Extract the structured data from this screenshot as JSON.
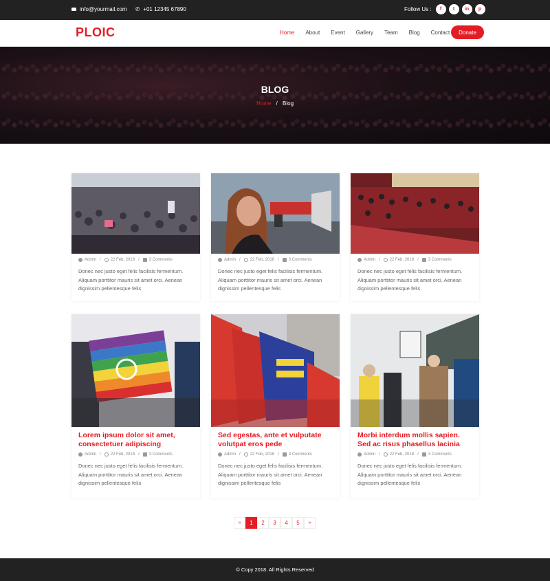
{
  "topbar": {
    "email": "info@yourmail.com",
    "phone": "+01 12345 67890",
    "follow_label": "Follow Us :",
    "social": [
      {
        "icon": "facebook-icon",
        "glyph": "f"
      },
      {
        "icon": "twitter-icon",
        "glyph": "t"
      },
      {
        "icon": "linkedin-icon",
        "glyph": "in"
      },
      {
        "icon": "pinterest-icon",
        "glyph": "p"
      }
    ]
  },
  "header": {
    "logo": "PLOIC",
    "nav": [
      "Home",
      "About",
      "Event",
      "Gallery",
      "Team",
      "Blog",
      "Contact"
    ],
    "active_nav": "Home",
    "donate": "Donate"
  },
  "hero": {
    "title": "BLOG",
    "crumb_home": "Home",
    "crumb_sep": "/",
    "crumb_current": "Blog"
  },
  "posts": [
    {
      "title": "",
      "author": "Admin",
      "date": "22 Feb, 2018",
      "comments": "3 Comments",
      "excerpt": "Donec nec justo eget felis facilisis fermentum. Aliquam porttitor mauris sit amet orci. Aenean dignissim pellentesque felis"
    },
    {
      "title": "",
      "author": "Admin",
      "date": "22 Feb, 2018",
      "comments": "3 Comments",
      "excerpt": "Donec nec justo eget felis facilisis fermentum. Aliquam porttitor mauris sit amet orci. Aenean dignissim pellentesque felis"
    },
    {
      "title": "",
      "author": "Admin",
      "date": "22 Feb, 2018",
      "comments": "3 Comments",
      "excerpt": "Donec nec justo eget felis facilisis fermentum. Aliquam porttitor mauris sit amet orci. Aenean dignissim pellentesque felis"
    },
    {
      "title": "Lorem ipsum dolor sit amet, consectetuer adipiscing",
      "author": "Admin",
      "date": "22 Feb, 2018",
      "comments": "3 Comments",
      "excerpt": "Donec nec justo eget felis facilisis fermentum. Aliquam porttitor mauris sit amet orci. Aenean dignissim pellentesque felis"
    },
    {
      "title": "Sed egestas, ante et vulputate volutpat eros pede",
      "author": "Admin",
      "date": "22 Feb, 2018",
      "comments": "3 Comments",
      "excerpt": "Donec nec justo eget felis facilisis fermentum. Aliquam porttitor mauris sit amet orci. Aenean dignissim pellentesque felis"
    },
    {
      "title": "Morbi interdum mollis sapien. Sed ac risus phasellus lacinia",
      "author": "Admin",
      "date": "22 Feb, 2018",
      "comments": "3 Comments",
      "excerpt": "Donec nec justo eget felis facilisis fermentum. Aliquam porttitor mauris sit amet orci. Aenean dignissim pellentesque felis"
    }
  ],
  "pager": {
    "prev": "«",
    "pages": [
      "1",
      "2",
      "3",
      "4",
      "5"
    ],
    "active": "1",
    "next": "»"
  },
  "footer": {
    "copyright": "© Copy 2018. All Rights Reserved"
  },
  "colors": {
    "accent": "#e41c24",
    "dark": "#222222"
  }
}
